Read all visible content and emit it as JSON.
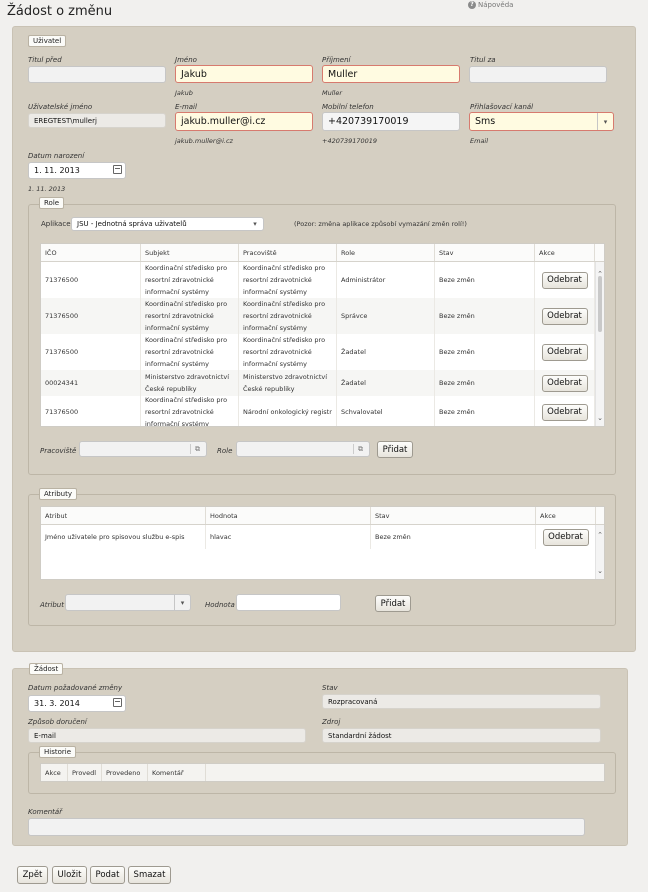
{
  "page": {
    "title": "Žádost o změnu",
    "help_label": "Nápověda"
  },
  "user": {
    "legend": "Uživatel",
    "title_before": {
      "label": "Titul před",
      "value": ""
    },
    "first_name": {
      "label": "Jméno",
      "value": "Jakub",
      "original": "Jakub"
    },
    "last_name": {
      "label": "Příjmení",
      "value": "Muller",
      "original": "Muller"
    },
    "title_after": {
      "label": "Titul za",
      "value": ""
    },
    "username": {
      "label": "Uživatelské jméno",
      "value": "EREGTEST\\mullerj"
    },
    "email": {
      "label": "E-mail",
      "value": "jakub.muller@i.cz",
      "original": "jakub.muller@i.cz"
    },
    "mobile": {
      "label": "Mobilní telefon",
      "value": "+420739170019",
      "original": "+420739170019"
    },
    "login_channel": {
      "label": "Přihlašovací kanál",
      "value": "Sms",
      "original": "Email"
    },
    "birth_date": {
      "label": "Datum narození",
      "value": "1. 11. 2013",
      "original": "1. 11. 2013"
    }
  },
  "roles": {
    "legend": "Role",
    "app_label": "Aplikace",
    "app_value": "JSU - Jednotná správa uživatelů",
    "app_note": "(Pozor: změna aplikace způsobí vymazání změn rolí!)",
    "columns": [
      "IČO",
      "Subjekt",
      "Pracoviště",
      "Role",
      "Stav",
      "Akce"
    ],
    "rows": [
      {
        "ico": "71376500",
        "subject": "Koordinační středisko pro resortní zdravotnické informační systémy",
        "workplace": "Koordinační středisko pro resortní zdravotnické informační systémy",
        "role": "Administrátor",
        "state": "Beze změn",
        "action": "Odebrat"
      },
      {
        "ico": "71376500",
        "subject": "Koordinační středisko pro resortní zdravotnické informační systémy",
        "workplace": "Koordinační středisko pro resortní zdravotnické informační systémy",
        "role": "Správce",
        "state": "Beze změn",
        "action": "Odebrat"
      },
      {
        "ico": "71376500",
        "subject": "Koordinační středisko pro resortní zdravotnické informační systémy",
        "workplace": "Koordinační středisko pro resortní zdravotnické informační systémy",
        "role": "Žadatel",
        "state": "Beze změn",
        "action": "Odebrat"
      },
      {
        "ico": "00024341",
        "subject": "Ministerstvo zdravotnictví České republiky",
        "workplace": "Ministerstvo zdravotnictví České republiky",
        "role": "Žadatel",
        "state": "Beze změn",
        "action": "Odebrat"
      },
      {
        "ico": "71376500",
        "subject": "Koordinační středisko pro resortní zdravotnické informační systémy",
        "workplace": "Národní onkologický registr",
        "role": "Schvalovatel",
        "state": "Beze změn",
        "action": "Odebrat"
      }
    ],
    "workplace_label": "Pracoviště",
    "role_label": "Role",
    "add_label": "Přidat"
  },
  "attributes": {
    "legend": "Atributy",
    "columns": [
      "Atribut",
      "Hodnota",
      "Stav",
      "Akce"
    ],
    "rows": [
      {
        "attribute": "Jméno uživatele pro spisovou službu e-spis",
        "value": "hlavac",
        "state": "Beze změn",
        "action": "Odebrat"
      }
    ],
    "attribute_label": "Atribut",
    "value_label": "Hodnota",
    "add_label": "Přidat"
  },
  "request": {
    "legend": "Žádost",
    "requested_date": {
      "label": "Datum požadované změny",
      "value": "31. 3. 2014"
    },
    "state": {
      "label": "Stav",
      "value": "Rozpracovaná"
    },
    "delivery": {
      "label": "Způsob doručení",
      "value": "E-mail"
    },
    "source": {
      "label": "Zdroj",
      "value": "Standardní žádost"
    },
    "history": {
      "legend": "Historie",
      "columns": [
        "Akce",
        "Provedl",
        "Provedeno",
        "Komentář"
      ]
    },
    "comment": {
      "label": "Komentář",
      "value": ""
    }
  },
  "footer": {
    "back": "Zpět",
    "save": "Uložit",
    "submit": "Podat",
    "delete": "Smazat"
  }
}
